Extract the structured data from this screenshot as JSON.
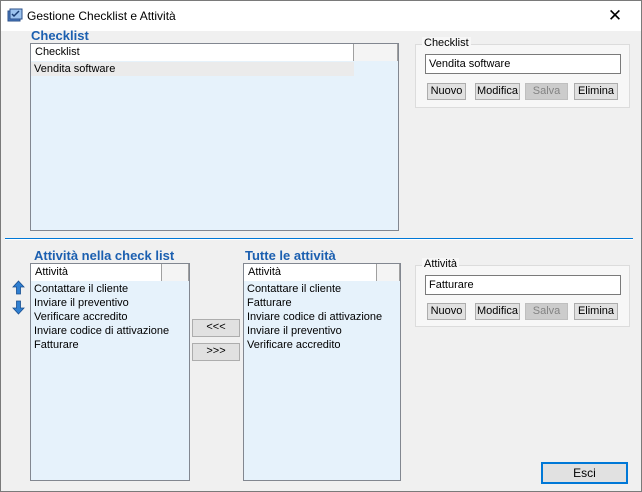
{
  "window": {
    "title": "Gestione Checklist e Attività",
    "close_glyph": "✕"
  },
  "checklist_section": {
    "title": "Checklist",
    "columns": [
      "Checklist",
      ""
    ],
    "rows": [
      "Vendita software"
    ],
    "selected_index": 0
  },
  "checklist_group": {
    "label": "Checklist",
    "value": "Vendita software",
    "buttons": {
      "new": "Nuovo",
      "edit": "Modifica",
      "save": "Salva",
      "delete": "Elimina"
    }
  },
  "assigned_section": {
    "title": "Attività nella check list",
    "columns": [
      "Attività",
      ""
    ],
    "rows": [
      "Contattare il cliente",
      "Inviare il preventivo",
      "Verificare accredito",
      "Inviare codice di attivazione",
      "Fatturare"
    ]
  },
  "all_section": {
    "title": "Tutte le attività",
    "columns": [
      "Attività",
      ""
    ],
    "rows": [
      "Contattare il cliente",
      "Fatturare",
      "Inviare codice di attivazione",
      "Inviare il preventivo",
      "Verificare accredito"
    ]
  },
  "transfer": {
    "add": "<<<",
    "remove": ">>>"
  },
  "activity_group": {
    "label": "Attività",
    "value": "Fatturare",
    "buttons": {
      "new": "Nuovo",
      "edit": "Modifica",
      "save": "Salva",
      "delete": "Elimina"
    }
  },
  "footer": {
    "exit": "Esci"
  },
  "colors": {
    "accent": "#1b5fb0",
    "list_background": "#e6f2fb",
    "window_background": "#f0f0f0",
    "divider": "#0078d7"
  },
  "icons": {
    "app": "checklist-app-icon",
    "move_up": "blue-arrow-up-icon",
    "move_down": "blue-arrow-down-icon"
  }
}
